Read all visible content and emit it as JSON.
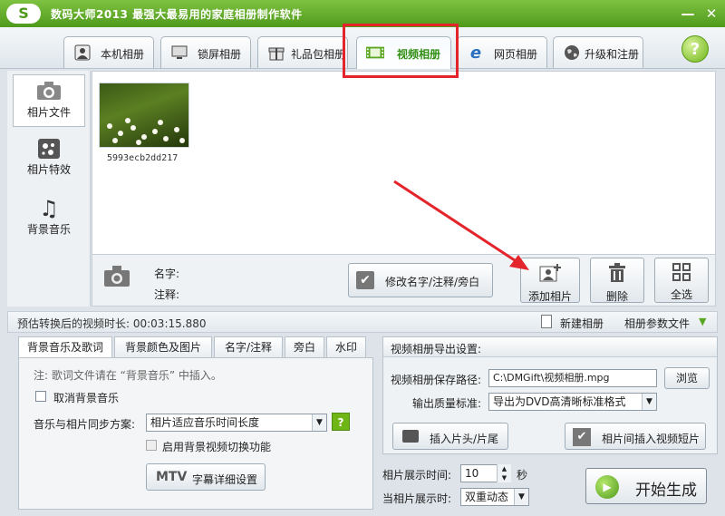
{
  "window": {
    "logo_text": "S",
    "title": "数码大师2013    最强大最易用的家庭相册制作软件",
    "minimize": "—",
    "close": "✕"
  },
  "tabs": [
    {
      "label": "本机相册",
      "icon": "portrait-icon"
    },
    {
      "label": "锁屏相册",
      "icon": "monitor-icon"
    },
    {
      "label": "礼品包相册",
      "icon": "gift-icon"
    },
    {
      "label": "视频相册",
      "icon": "film-icon",
      "active": true
    },
    {
      "label": "网页相册",
      "icon": "ie-icon"
    },
    {
      "label": "升级和注册",
      "icon": "globe-icon"
    }
  ],
  "help_label": "?",
  "sidebar": {
    "items": [
      {
        "label": "相片文件",
        "icon": "camera-icon"
      },
      {
        "label": "相片特效",
        "icon": "effects-icon"
      },
      {
        "label": "背景音乐",
        "icon": "music-note-icon"
      }
    ]
  },
  "photos": [
    {
      "filename": "5993ecb2dd217"
    }
  ],
  "info": {
    "name_label": "名字:",
    "note_label": "注释:",
    "edit_button": "修改名字/注释/旁白",
    "add_button": "添加相片",
    "delete_button": "删除",
    "select_all_button": "全选"
  },
  "status": {
    "duration_text": "预估转换后的视频时长: 00:03:15.880",
    "new_album": "新建相册",
    "album_params": "相册参数文件"
  },
  "subtabs": [
    "背景音乐及歌词",
    "背景颜色及图片",
    "名字/注释",
    "旁白",
    "水印"
  ],
  "music": {
    "note": "注: 歌词文件请在 “背景音乐” 中插入。",
    "cancel_bg_music": "取消背景音乐",
    "sync_label": "音乐与相片同步方案:",
    "sync_value": "相片适应音乐时间长度",
    "help": "?",
    "enable_bg_video": "启用背景视频切换功能",
    "mtv_button_badge": "MTV",
    "mtv_button": "字幕详细设置"
  },
  "export": {
    "header": "视频相册导出设置:",
    "path_label": "视频相册保存路径:",
    "path_value": "C:\\DMGift\\视频相册.mpg",
    "browse": "浏览",
    "quality_label": "输出质量标准:",
    "quality_value": "导出为DVD高清晰标准格式",
    "insert_head_tail": "插入片头/片尾",
    "insert_between": "相片间插入视频短片",
    "display_time_label": "相片展示时间:",
    "display_time_value": "10",
    "display_time_unit": "秒",
    "display_mode_label": "当相片展示时:",
    "display_mode_value": "双重动态",
    "start_button": "开始生成"
  },
  "colors": {
    "brand_green": "#5aa521",
    "annotation_red": "#e3242b"
  }
}
